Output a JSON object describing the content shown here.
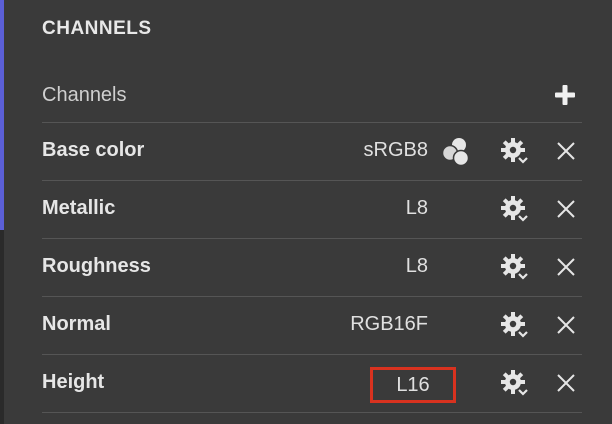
{
  "panel": {
    "title": "CHANNELS",
    "subtitle": "Channels",
    "add_icon": "plus-icon"
  },
  "channels": [
    {
      "name": "Base color",
      "format": "sRGB8",
      "colorspace_icon": "color-circles-icon",
      "settings_icon": "gear-icon",
      "remove_icon": "close-icon"
    },
    {
      "name": "Metallic",
      "format": "L8",
      "settings_icon": "gear-icon",
      "remove_icon": "close-icon"
    },
    {
      "name": "Roughness",
      "format": "L8",
      "settings_icon": "gear-icon",
      "remove_icon": "close-icon"
    },
    {
      "name": "Normal",
      "format": "RGB16F",
      "settings_icon": "gear-icon",
      "remove_icon": "close-icon"
    },
    {
      "name": "Height",
      "format": "L16",
      "settings_icon": "gear-icon",
      "remove_icon": "close-icon",
      "highlighted": true
    }
  ],
  "colors": {
    "background": "#3a3a3a",
    "accent_edge": "#5b5fd6",
    "highlight": "#d8321f"
  }
}
